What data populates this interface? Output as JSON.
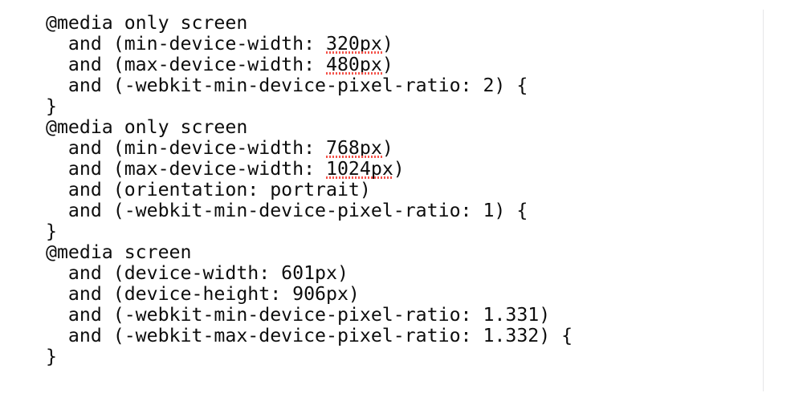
{
  "editor": {
    "background_color": "#ffffff",
    "text_color": "#0d0d0d",
    "spellcheck_underline_color": "#f4534a",
    "divider_color": "#e6e6e8",
    "lines": [
      {
        "indent": "",
        "text": "@media only screen"
      },
      {
        "indent": "  ",
        "before": "and (min-device-width: ",
        "marked": "320px",
        "after": ")"
      },
      {
        "indent": "  ",
        "before": "and (max-device-width: ",
        "marked": "480px",
        "after": ")"
      },
      {
        "indent": "  ",
        "text": "and (-webkit-min-device-pixel-ratio: 2) {"
      },
      {
        "indent": "",
        "text": "}"
      },
      {
        "indent": "",
        "text": "@media only screen"
      },
      {
        "indent": "  ",
        "before": "and (min-device-width: ",
        "marked": "768px",
        "after": ")"
      },
      {
        "indent": "  ",
        "before": "and (max-device-width: ",
        "marked": "1024px",
        "after": ")"
      },
      {
        "indent": "  ",
        "text": "and (orientation: portrait)"
      },
      {
        "indent": "  ",
        "text": "and (-webkit-min-device-pixel-ratio: 1) {"
      },
      {
        "indent": "",
        "text": "}"
      },
      {
        "indent": "",
        "text": "@media screen"
      },
      {
        "indent": "  ",
        "text": "and (device-width: 601px)"
      },
      {
        "indent": "  ",
        "text": "and (device-height: 906px)"
      },
      {
        "indent": "  ",
        "text": "and (-webkit-min-device-pixel-ratio: 1.331)"
      },
      {
        "indent": "  ",
        "text": "and (-webkit-max-device-pixel-ratio: 1.332) {"
      },
      {
        "indent": "",
        "text": "}"
      }
    ]
  }
}
